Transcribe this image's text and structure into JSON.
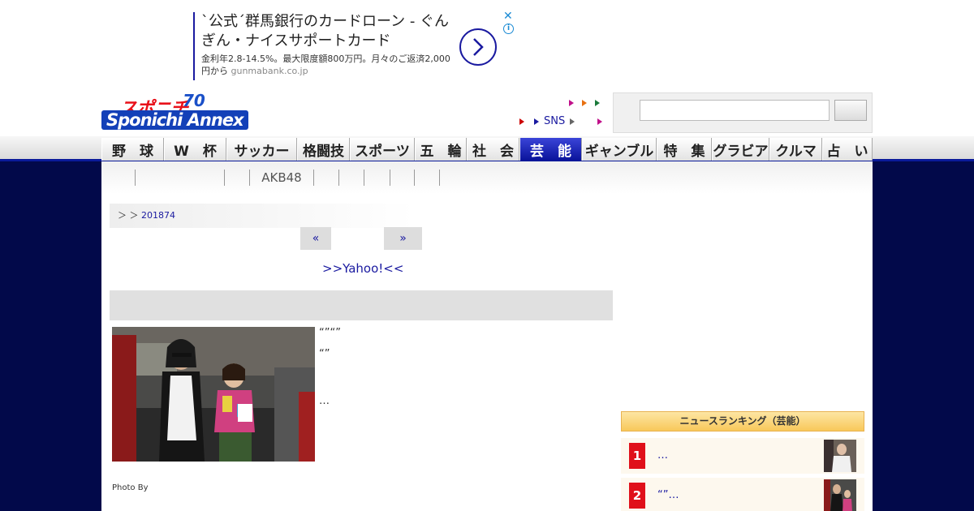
{
  "ad": {
    "title": "`公式´群馬銀行のカードローン - ぐんぎん・ナイスサポートカード",
    "description": "金利年2.8-14.5%。最大限度額800万円。月々のご返済2,000円から",
    "domain": "gunmabank.co.jp",
    "close_label": "✕",
    "info_label": "i"
  },
  "logo": {
    "top_text": "スポニチ",
    "bottom_text": "Sponichi Annex",
    "anniversary": "70"
  },
  "header_links": {
    "sns": "SNS"
  },
  "colors": {
    "navy": "#02094a",
    "accent": "#1a1aa0",
    "rank_red": "#e0101a"
  },
  "nav": {
    "items": [
      {
        "label": "野　球"
      },
      {
        "label": "W　杯"
      },
      {
        "label": "サッカー"
      },
      {
        "label": "格闘技"
      },
      {
        "label": "スポーツ"
      },
      {
        "label": "五　輪"
      },
      {
        "label": "社　会"
      },
      {
        "label": "芸　能"
      },
      {
        "label": "ギャンブル"
      },
      {
        "label": "特　集"
      },
      {
        "label": "グラビア"
      },
      {
        "label": "クルマ"
      },
      {
        "label": "占　い"
      }
    ]
  },
  "subnav": {
    "akb": "AKB48"
  },
  "breadcrumb": {
    "sep1": "＞",
    "sep2": "＞",
    "date": "201874"
  },
  "pager": {
    "prev": "«",
    "next": "»"
  },
  "yahoo_link": ">>Yahoo!<<",
  "article": {
    "line1": "“”“”",
    "line2": "“”",
    "line3": "…",
    "photo_by": "Photo By"
  },
  "ranking": {
    "title": "ニュースランキング（芸能）",
    "items": [
      {
        "rank": "1",
        "text": "…"
      },
      {
        "rank": "2",
        "text": "“”…"
      }
    ]
  }
}
